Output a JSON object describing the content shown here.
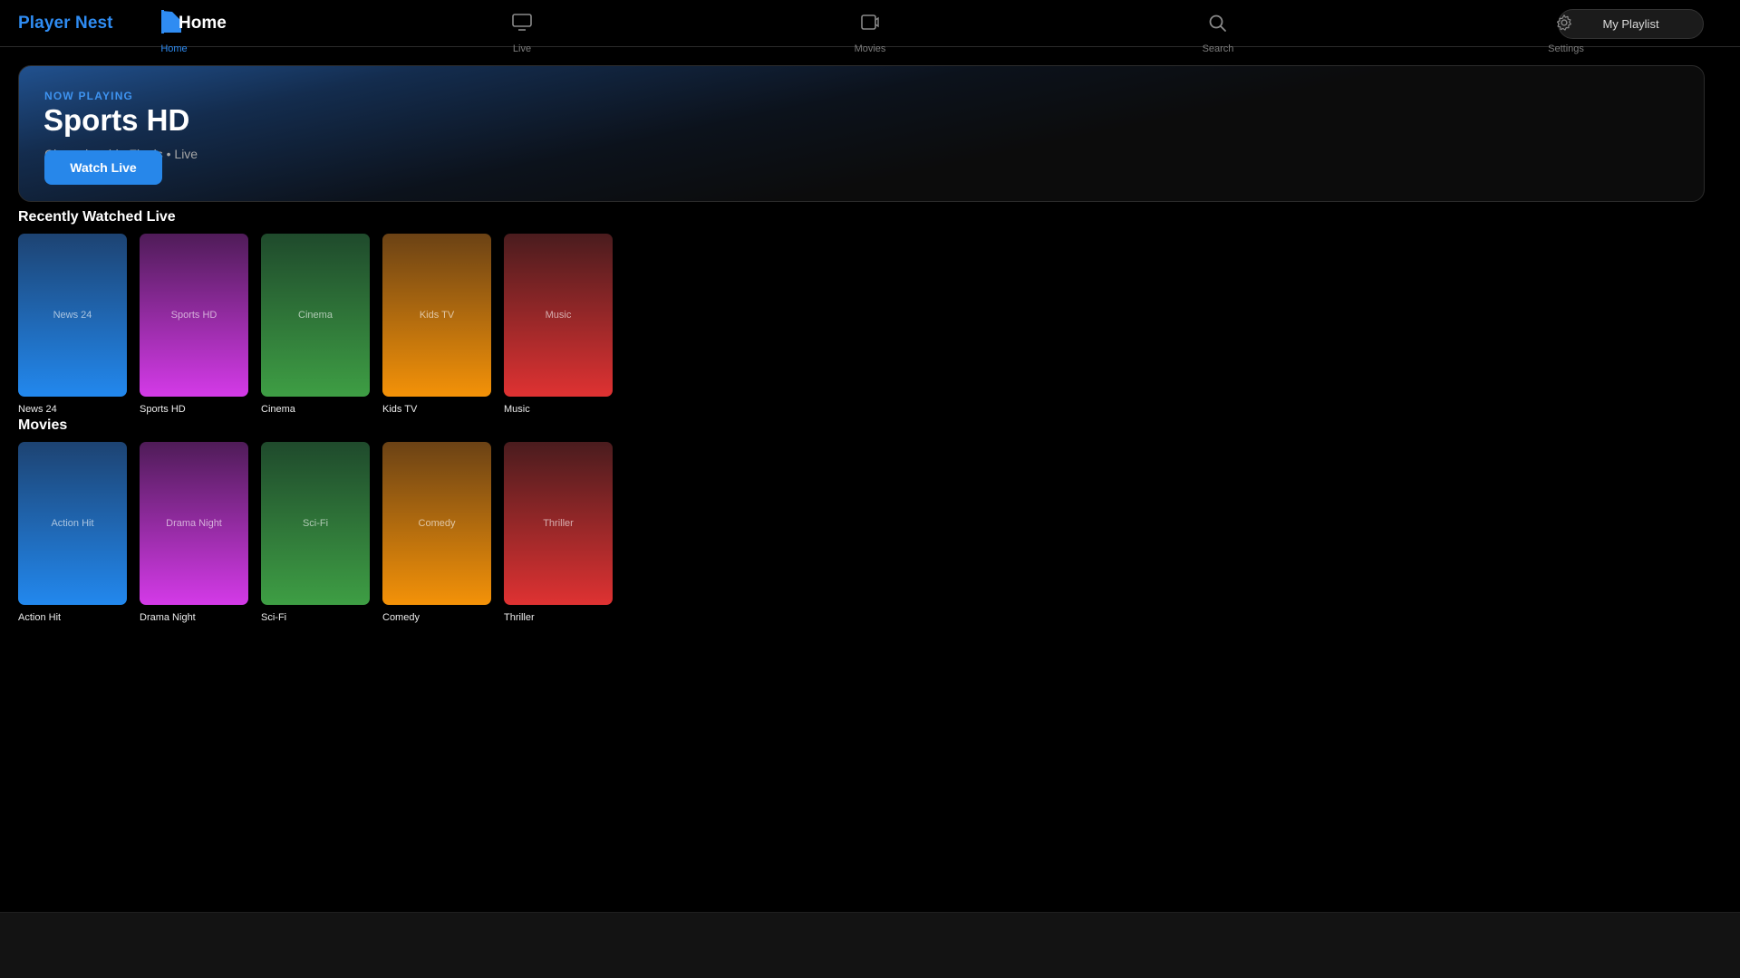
{
  "app": {
    "brand": "Player Nest"
  },
  "nav": {
    "items": [
      {
        "label": "Home",
        "icon": "home-icon",
        "active": true
      },
      {
        "label": "Live",
        "icon": "tv-icon",
        "active": false
      },
      {
        "label": "Movies",
        "icon": "video-icon",
        "active": false
      },
      {
        "label": "Search",
        "icon": "search-icon",
        "active": false
      },
      {
        "label": "Settings",
        "icon": "gear-icon",
        "active": false
      }
    ],
    "home_overlay_text": "Home",
    "playlist_button": "My Playlist"
  },
  "hero": {
    "eyebrow": "NOW PLAYING",
    "title": "Sports HD",
    "subtitle": "Championship Finals • Live",
    "button": "Watch Live"
  },
  "sections": [
    {
      "title": "Recently Watched Live",
      "tiles": [
        {
          "label": "News 24",
          "color": "blue"
        },
        {
          "label": "Sports HD",
          "color": "purple"
        },
        {
          "label": "Cinema",
          "color": "green"
        },
        {
          "label": "Kids TV",
          "color": "orange"
        },
        {
          "label": "Music",
          "color": "red"
        }
      ]
    },
    {
      "title": "Movies",
      "tiles": [
        {
          "label": "Action Hit",
          "color": "blue"
        },
        {
          "label": "Drama Night",
          "color": "purple"
        },
        {
          "label": "Sci-Fi",
          "color": "green"
        },
        {
          "label": "Comedy",
          "color": "orange"
        },
        {
          "label": "Thriller",
          "color": "red"
        }
      ]
    }
  ],
  "colors": {
    "accent": "#2f8cf2",
    "background": "#000000",
    "button": "#2787ea"
  }
}
